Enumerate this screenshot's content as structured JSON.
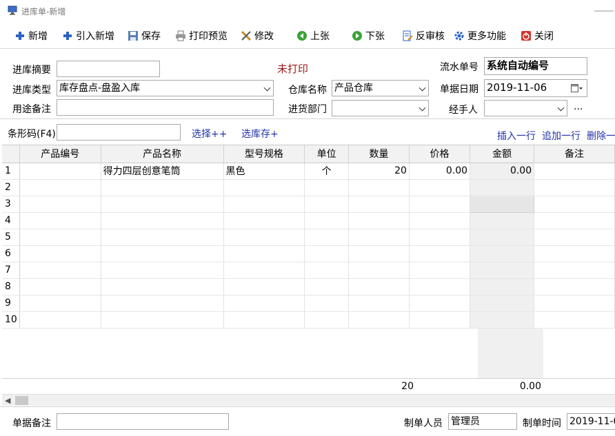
{
  "window": {
    "title": "进库单-新增"
  },
  "toolbar": {
    "new": "新增",
    "import_new": "引入新增",
    "save": "保存",
    "print_preview": "打印预览",
    "modify": "修改",
    "prev": "上张",
    "next": "下张",
    "unapprove": "反审核",
    "more": "更多功能",
    "close": "关闭"
  },
  "form": {
    "summary_label": "进库摘要",
    "summary_value": "",
    "status_text": "未打印",
    "serial_label": "流水单号",
    "serial_value": "系统自动编号",
    "type_label": "进库类型",
    "type_value": "库存盘点-盘盈入库",
    "warehouse_label": "仓库名称",
    "warehouse_value": "产品仓库",
    "date_label": "单据日期",
    "date_value": "2019-11-06",
    "purpose_label": "用途备注",
    "purpose_value": "",
    "dept_label": "进货部门",
    "dept_value": "",
    "handler_label": "经手人",
    "handler_value": "",
    "handler_more": "..."
  },
  "barcode": {
    "label": "条形码(F4)",
    "value": "",
    "select_link": "选择++",
    "select_stock_link": "选库存+",
    "insert_row": "插入一行",
    "append_row": "追加一行",
    "delete_row": "删除一"
  },
  "grid": {
    "columns": [
      "产品编号",
      "产品名称",
      "型号规格",
      "单位",
      "数量",
      "价格",
      "金额",
      "备注"
    ],
    "rows": [
      {
        "no": "1",
        "code": "",
        "name": "得力四层创意笔筒",
        "spec": "黑色",
        "unit": "个",
        "qty": "20",
        "price": "0.00",
        "amount": "0.00",
        "remark": ""
      },
      {
        "no": "2",
        "code": "",
        "name": "",
        "spec": "",
        "unit": "",
        "qty": "",
        "price": "",
        "amount": "",
        "remark": ""
      },
      {
        "no": "3",
        "code": "",
        "name": "",
        "spec": "",
        "unit": "",
        "qty": "",
        "price": "",
        "amount": "",
        "remark": ""
      },
      {
        "no": "4",
        "code": "",
        "name": "",
        "spec": "",
        "unit": "",
        "qty": "",
        "price": "",
        "amount": "",
        "remark": ""
      },
      {
        "no": "5",
        "code": "",
        "name": "",
        "spec": "",
        "unit": "",
        "qty": "",
        "price": "",
        "amount": "",
        "remark": ""
      },
      {
        "no": "6",
        "code": "",
        "name": "",
        "spec": "",
        "unit": "",
        "qty": "",
        "price": "",
        "amount": "",
        "remark": ""
      },
      {
        "no": "7",
        "code": "",
        "name": "",
        "spec": "",
        "unit": "",
        "qty": "",
        "price": "",
        "amount": "",
        "remark": ""
      },
      {
        "no": "8",
        "code": "",
        "name": "",
        "spec": "",
        "unit": "",
        "qty": "",
        "price": "",
        "amount": "",
        "remark": ""
      },
      {
        "no": "9",
        "code": "",
        "name": "",
        "spec": "",
        "unit": "",
        "qty": "",
        "price": "",
        "amount": "",
        "remark": ""
      },
      {
        "no": "10",
        "code": "",
        "name": "",
        "spec": "",
        "unit": "",
        "qty": "",
        "price": "",
        "amount": "",
        "remark": ""
      }
    ],
    "total_qty": "20",
    "total_amount": "0.00"
  },
  "footer": {
    "note_label": "单据备注",
    "note_value": "",
    "creator_label": "制单人员",
    "creator_value": "管理员",
    "time_label": "制单时间",
    "time_value": "2019-11-0"
  },
  "icons": {
    "app": "monitor-icon",
    "new": "plus-icon",
    "import_new": "plus-icon",
    "save": "floppy-disk-icon",
    "print_preview": "printer-icon",
    "modify": "pencil-tools-icon",
    "prev": "green-left-arrow-icon",
    "next": "green-right-arrow-icon",
    "unapprove": "document-edit-icon",
    "more": "gear-icon",
    "close": "power-icon"
  },
  "colors": {
    "status_red": "#9c1a1a",
    "link_blue": "#2233a8",
    "plus_blue": "#2c62c8",
    "nav_green": "#3aa236",
    "close_red": "#d6302a"
  }
}
